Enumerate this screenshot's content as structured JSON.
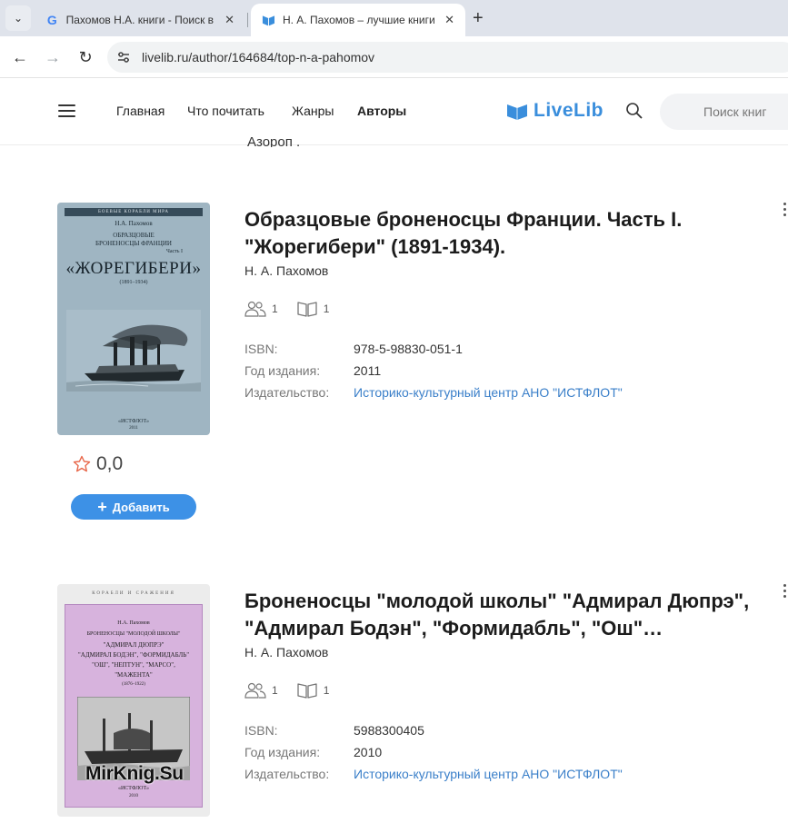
{
  "browser": {
    "tabs": [
      {
        "title": "Пахомов Н.А. книги - Поиск в Google",
        "icon": "google-icon"
      },
      {
        "title": "Н. А. Пахомов – лучшие книги",
        "icon": "livelib-icon"
      }
    ],
    "url": "livelib.ru/author/164684/top-n-a-pahomov"
  },
  "site": {
    "nav": [
      "Главная",
      "Что почитать",
      "Жанры",
      "Авторы"
    ],
    "logo": "LiveLib",
    "search_placeholder": "Поиск книг",
    "accent": "#3d91e6"
  },
  "partial_text": "Азороп .",
  "books": [
    {
      "title": "Образцовые броненосцы Франции. Часть I. \"Жорегибери\" (1891-1934).",
      "author": "Н. А. Пахомов",
      "readers": "1",
      "reviews": "1",
      "isbn_label": "ISBN:",
      "isbn": "978-5-98830-051-1",
      "year_label": "Год издания:",
      "year": "2011",
      "publisher_label": "Издательство:",
      "publisher": "Историко-культурный центр АНО \"ИСТФЛОТ\"",
      "rating": "0,0",
      "add_label": "Добавить",
      "cover": {
        "series": "БОЕВЫЕ КОРАБЛИ МИРА",
        "author": "Н.А. Пахомов",
        "line1": "ОБРАЗЦОВЫЕ",
        "line2": "БРОНЕНОСЦЫ ФРАНЦИИ",
        "line3": "Часть I",
        "big": "«ЖОРЕГИБЕРИ»",
        "years": "(1891–1934)",
        "publisher": "«ИСТФЛОТ»",
        "year": "2011"
      }
    },
    {
      "title": "Броненосцы \"молодой школы\" \"Адмирал Дюпрэ\", \"Адмирал Бодэн\", \"Формидабль\", \"Ош\"…",
      "author": "Н. А. Пахомов",
      "readers": "1",
      "reviews": "1",
      "isbn_label": "ISBN:",
      "isbn": "5988300405",
      "year_label": "Год издания:",
      "year": "2010",
      "publisher_label": "Издательство:",
      "publisher": "Историко-культурный центр АНО \"ИСТФЛОТ\"",
      "cover": {
        "series": "КОРАБЛИ И СРАЖЕНИЯ",
        "author": "Н.А. Пахомов",
        "line1": "БРОНЕНОСЦЫ \"МОЛОДОЙ ШКОЛЫ\"",
        "line2": "\"АДМИРАЛ ДЮПРЭ\"",
        "line3": "\"АДМИРАЛ БОДЭН\", \"ФОРМИДАБЛЬ\"",
        "line4": "\"ОШ\", \"НЕПТУН\", \"МАРСО\",",
        "line5": "\"МАЖЕНТА\"",
        "years": "(1876–1922)",
        "publisher": "«ИСТФЛОТ»",
        "year": "2010",
        "watermark": "MirKnig.Su"
      }
    }
  ]
}
